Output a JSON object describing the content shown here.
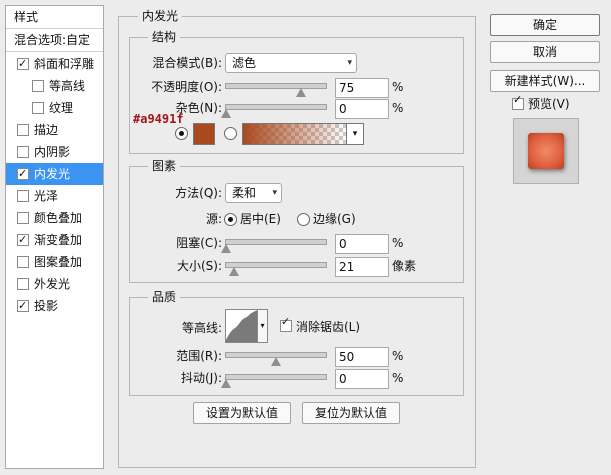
{
  "left_panel": {
    "header": "样式",
    "blend_options": "混合选项:自定",
    "items": [
      {
        "label": "斜面和浮雕",
        "checked": true,
        "indent": false,
        "selected": false
      },
      {
        "label": "等高线",
        "checked": false,
        "indent": true,
        "selected": false
      },
      {
        "label": "纹理",
        "checked": false,
        "indent": true,
        "selected": false
      },
      {
        "label": "描边",
        "checked": false,
        "indent": false,
        "selected": false
      },
      {
        "label": "内阴影",
        "checked": false,
        "indent": false,
        "selected": false
      },
      {
        "label": "内发光",
        "checked": true,
        "indent": false,
        "selected": true
      },
      {
        "label": "光泽",
        "checked": false,
        "indent": false,
        "selected": false
      },
      {
        "label": "颜色叠加",
        "checked": false,
        "indent": false,
        "selected": false
      },
      {
        "label": "渐变叠加",
        "checked": true,
        "indent": false,
        "selected": false
      },
      {
        "label": "图案叠加",
        "checked": false,
        "indent": false,
        "selected": false
      },
      {
        "label": "外发光",
        "checked": false,
        "indent": false,
        "selected": false
      },
      {
        "label": "投影",
        "checked": true,
        "indent": false,
        "selected": false
      }
    ]
  },
  "panel_title": "内发光",
  "structure": {
    "title": "结构",
    "blend_mode_label": "混合模式(B):",
    "blend_mode_value": "滤色",
    "opacity_label": "不透明度(O):",
    "opacity_value": "75",
    "opacity_level": 0.75,
    "noise_label": "杂色(N):",
    "noise_value": "0",
    "noise_level": 0,
    "percent": "%",
    "color_hex_annotation": "#a9491f",
    "swatch_color": "#a9491f"
  },
  "elements": {
    "title": "图素",
    "method_label": "方法(Q):",
    "method_value": "柔和",
    "source_label": "源:",
    "source_center": "居中(E)",
    "source_edge": "边缘(G)",
    "choke_label": "阻塞(C):",
    "choke_value": "0",
    "choke_level": 0,
    "size_label": "大小(S):",
    "size_value": "21",
    "size_level": 0.084,
    "size_unit": "像素",
    "percent": "%"
  },
  "quality": {
    "title": "品质",
    "contour_label": "等高线:",
    "antialias_label": "消除锯齿(L)",
    "range_label": "范围(R):",
    "range_value": "50",
    "range_level": 0.5,
    "jitter_label": "抖动(J):",
    "jitter_value": "0",
    "jitter_level": 0,
    "percent": "%"
  },
  "bottom": {
    "make_default": "设置为默认值",
    "reset_default": "复位为默认值"
  },
  "right": {
    "ok": "确定",
    "cancel": "取消",
    "new_style": "新建样式(W)...",
    "preview": "预览(V)"
  },
  "icons": {
    "check": "checkmark-icon",
    "dropdown": "chevron-down-icon"
  }
}
